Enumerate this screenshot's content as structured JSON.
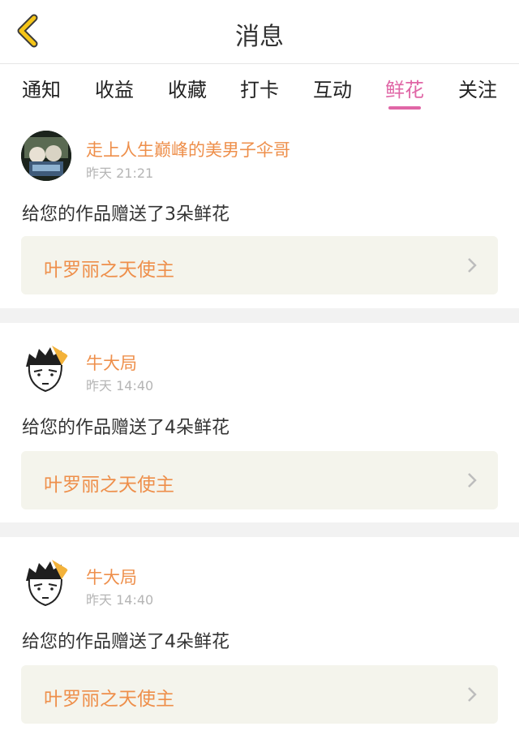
{
  "header": {
    "title": "消息"
  },
  "tabs": [
    {
      "label": "通知"
    },
    {
      "label": "收益"
    },
    {
      "label": "收藏"
    },
    {
      "label": "打卡"
    },
    {
      "label": "互动"
    },
    {
      "label": "鲜花",
      "active": true
    },
    {
      "label": "关注"
    }
  ],
  "accent_color": "#e066a6",
  "name_color": "#ee8f4b",
  "messages": [
    {
      "user": "走上人生巅峰的美男子伞哥",
      "time": "昨天 21:21",
      "text": "给您的作品赠送了3朵鲜花",
      "work": "叶罗丽之天使主",
      "avatar_icon": "photo-avatar"
    },
    {
      "user": "牛大局",
      "time": "昨天 14:40",
      "text": "给您的作品赠送了4朵鲜花",
      "work": "叶罗丽之天使主",
      "avatar_icon": "cartoon-face-avatar"
    },
    {
      "user": "牛大局",
      "time": "昨天 14:40",
      "text": "给您的作品赠送了4朵鲜花",
      "work": "叶罗丽之天使主",
      "avatar_icon": "cartoon-face-avatar"
    }
  ]
}
